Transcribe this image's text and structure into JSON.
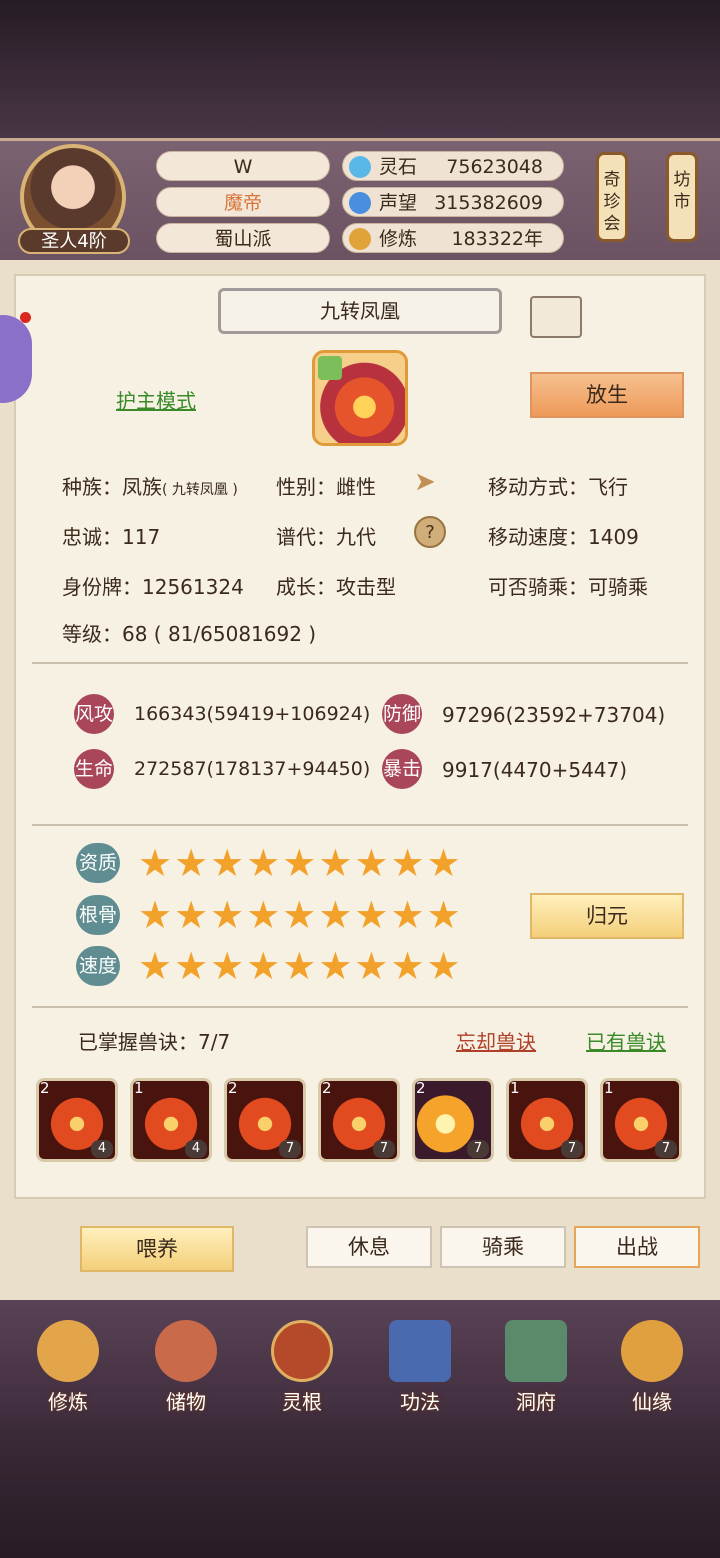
{
  "header": {
    "rank": "圣人4阶",
    "player_name": "W",
    "title": "魔帝",
    "sect": "蜀山派",
    "resources": [
      {
        "label": "灵石",
        "value": "75623048",
        "icon": "spirit-stone-icon"
      },
      {
        "label": "声望",
        "value": "315382609",
        "icon": "prestige-icon"
      },
      {
        "label": "修炼",
        "value": "183322年",
        "icon": "cultivation-icon"
      }
    ],
    "side_buttons": [
      "奇珍会",
      "坊市"
    ]
  },
  "pet": {
    "name": "九转凤凰",
    "mode_link": "护主模式",
    "release_button": "放生",
    "info": [
      {
        "label": "种族：",
        "value": "凤族",
        "sub": "( 九转凤凰 )"
      },
      {
        "label": "性别：",
        "value": "雌性"
      },
      {
        "label": "移动方式：",
        "value": "飞行"
      },
      {
        "label": "忠诚：",
        "value": "117"
      },
      {
        "label": "谱代：",
        "value": "九代"
      },
      {
        "label": "移动速度：",
        "value": "1409"
      },
      {
        "label": "身份牌：",
        "value": "12561324"
      },
      {
        "label": "成长：",
        "value": "攻击型"
      },
      {
        "label": "可否骑乘：",
        "value": "可骑乘"
      },
      {
        "label": "等级：",
        "value": "68 ( 81/65081692 )"
      }
    ],
    "stats": [
      {
        "badge": "风攻",
        "value": "166343(59419+106924)"
      },
      {
        "badge": "防御",
        "value": "97296(23592+73704)"
      },
      {
        "badge": "生命",
        "value": "272587(178137+94450)"
      },
      {
        "badge": "暴击",
        "value": "9917(4470+5447)"
      }
    ],
    "aptitudes": [
      {
        "label": "资质",
        "stars": 9
      },
      {
        "label": "根骨",
        "stars": 9
      },
      {
        "label": "速度",
        "stars": 9
      }
    ],
    "reset_button": "归元",
    "skills_label": "已掌握兽诀：7/7",
    "forget_link": "忘却兽诀",
    "owned_link": "已有兽诀",
    "skills": [
      {
        "tier": "2",
        "level": "4"
      },
      {
        "tier": "1",
        "level": "4"
      },
      {
        "tier": "2",
        "level": "7"
      },
      {
        "tier": "2",
        "level": "7"
      },
      {
        "tier": "2",
        "level": "7"
      },
      {
        "tier": "1",
        "level": "7"
      },
      {
        "tier": "1",
        "level": "7"
      }
    ]
  },
  "actions": {
    "feed": "喂养",
    "rest": "休息",
    "ride": "骑乘",
    "battle": "出战"
  },
  "nav": [
    {
      "label": "修炼",
      "icon": "meditation-icon"
    },
    {
      "label": "储物",
      "icon": "bag-icon"
    },
    {
      "label": "灵根",
      "icon": "spirit-root-icon"
    },
    {
      "label": "功法",
      "icon": "scroll-book-icon"
    },
    {
      "label": "洞府",
      "icon": "cave-house-icon"
    },
    {
      "label": "仙缘",
      "icon": "gourd-icon"
    }
  ],
  "colors": {
    "accent_orange": "#ee9a5a",
    "star": "#f2a22b",
    "link_green": "#3a8a2a",
    "link_red": "#b0402a"
  }
}
